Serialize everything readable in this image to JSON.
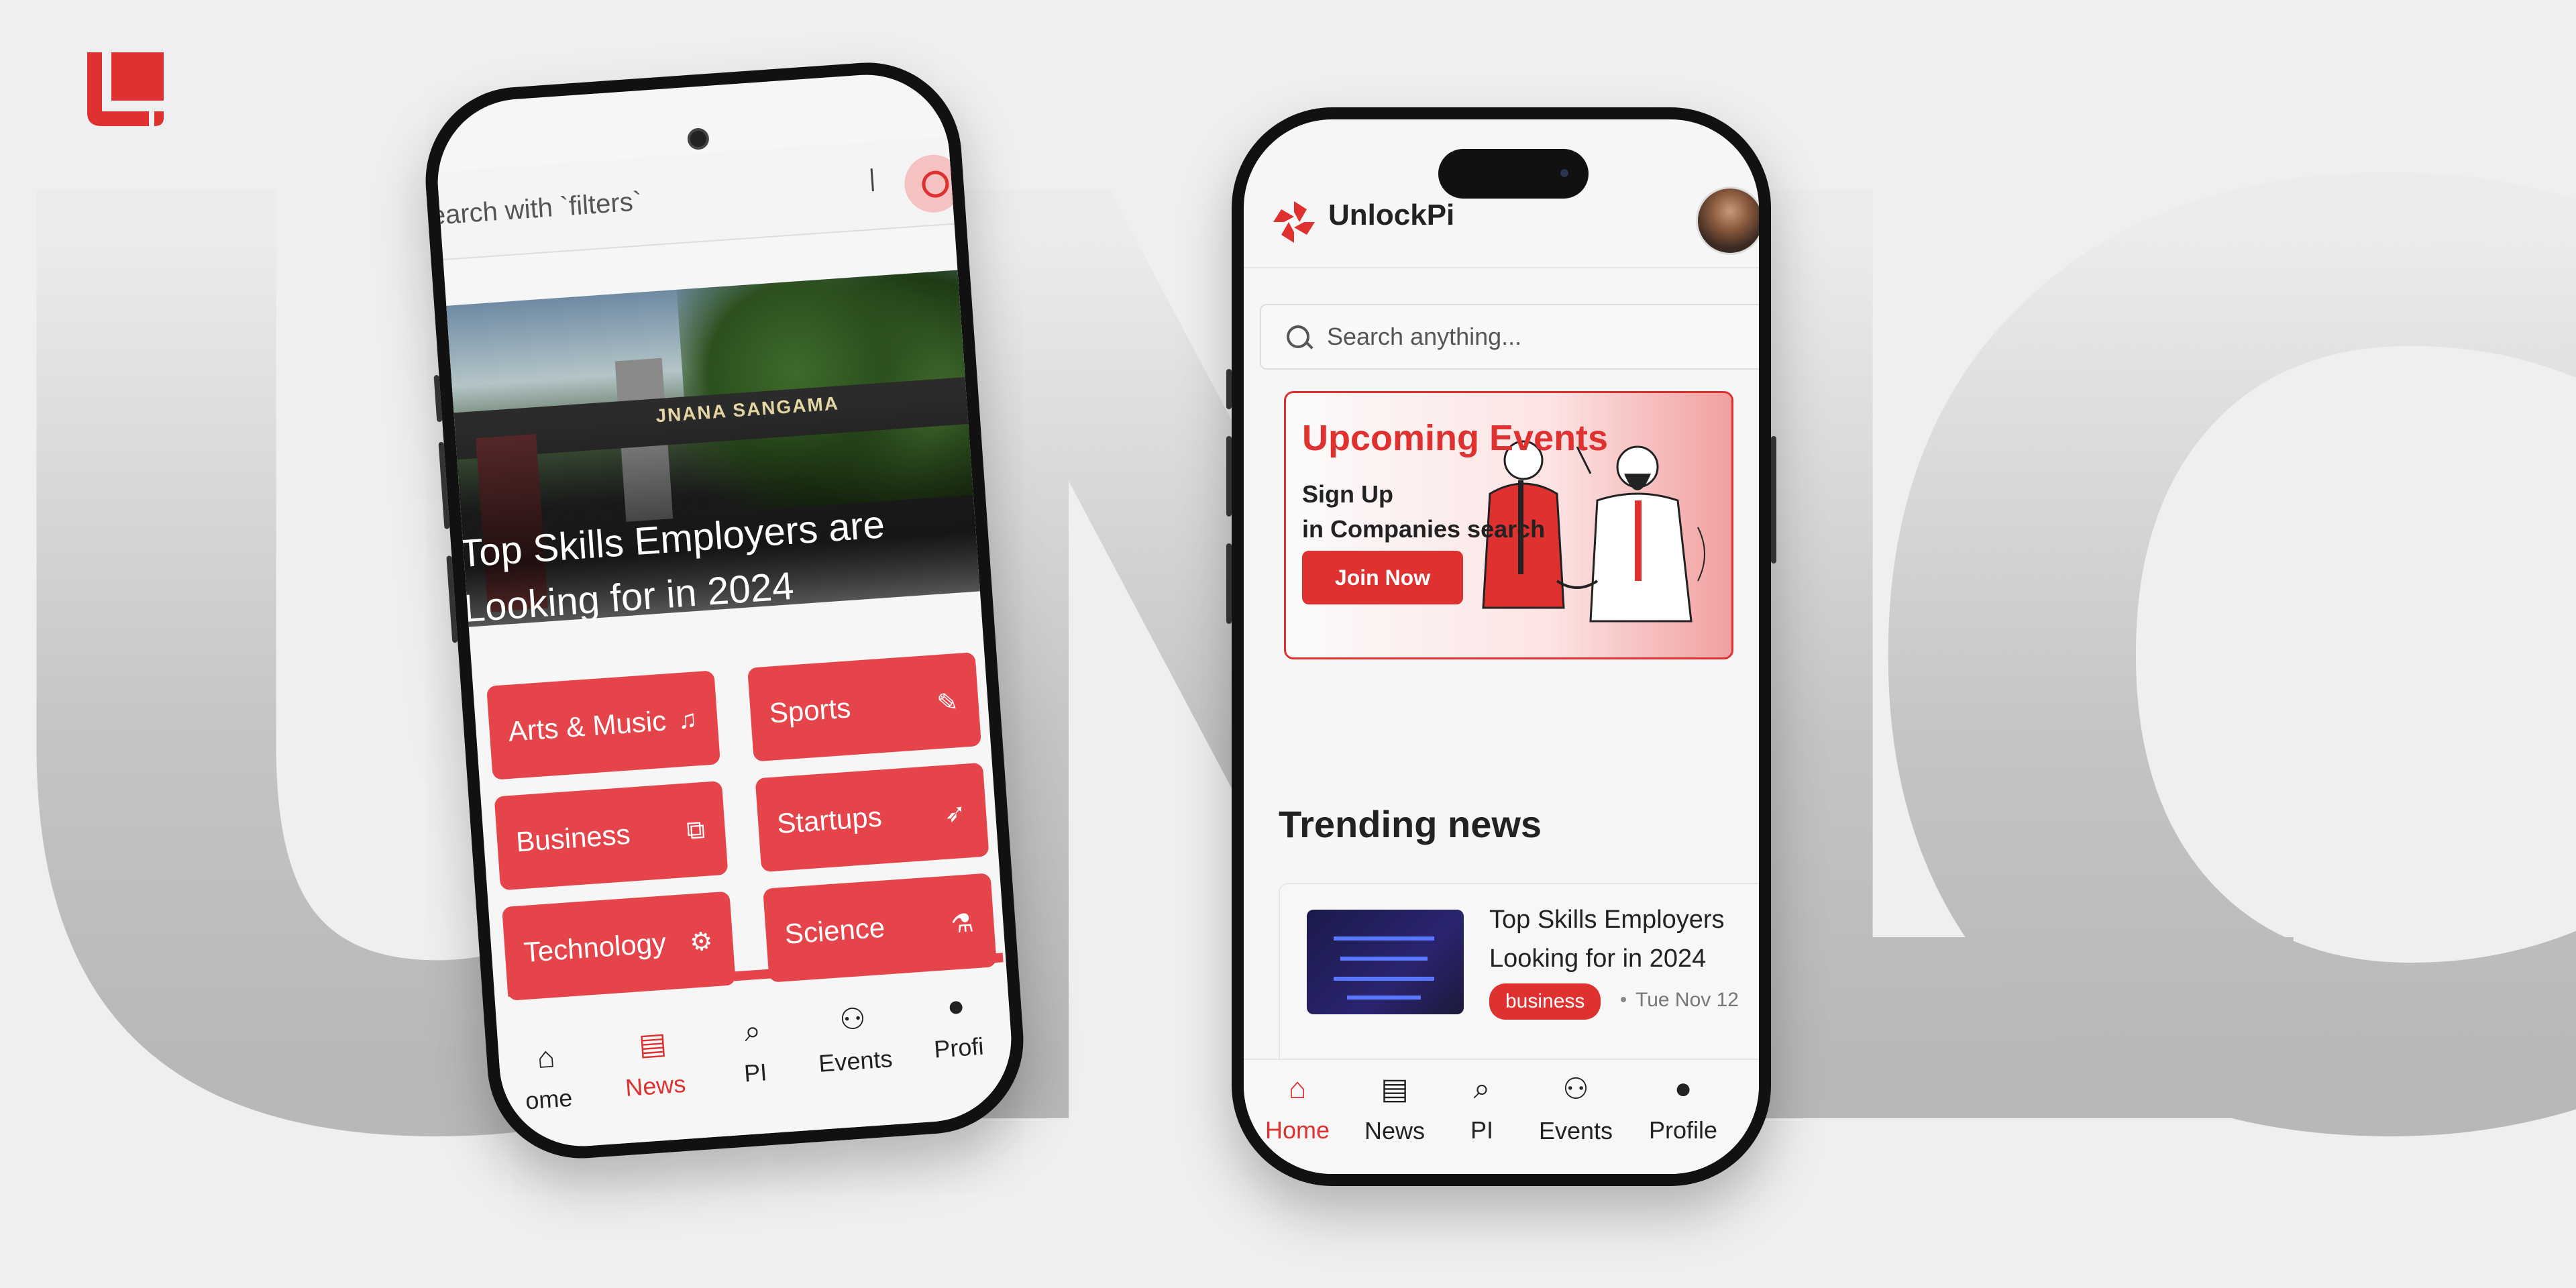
{
  "background": {
    "letters": [
      "U",
      "N",
      "L",
      "C"
    ]
  },
  "left_phone": {
    "search_placeholder": "earch with `filters`",
    "hero_title": "Top Skills Employers are Looking for in 2024",
    "hero_gate_text": "JNANA SANGAMA",
    "categories": [
      {
        "label": "Arts & Music",
        "icon": "♫"
      },
      {
        "label": "Sports",
        "icon": "✎"
      },
      {
        "label": "Business",
        "icon": "⧉"
      },
      {
        "label": "Startups",
        "icon": "➶"
      },
      {
        "label": "Technology",
        "icon": "⚙"
      },
      {
        "label": "Science",
        "icon": "⚗"
      }
    ],
    "nav": [
      {
        "label": "ome",
        "icon": "⌂",
        "active": false
      },
      {
        "label": "News",
        "icon": "▤",
        "active": true
      },
      {
        "label": "PI",
        "icon": "⌕",
        "active": false
      },
      {
        "label": "Events",
        "icon": "⚇",
        "active": false
      },
      {
        "label": "Profi",
        "icon": "●",
        "active": false
      }
    ]
  },
  "right_phone": {
    "brand": "UnlockPi",
    "search_placeholder": "Search anything...",
    "banner": {
      "title": "Upcoming Events",
      "line1": "Sign Up",
      "line2": "in Companies search",
      "button": "Join Now"
    },
    "trending_title": "Trending news",
    "news_card": {
      "title": "Top Skills Employers Looking for in 2024",
      "tag": "business",
      "date": "Tue Nov 12"
    },
    "nav": [
      {
        "label": "Home",
        "icon": "⌂",
        "active": true
      },
      {
        "label": "News",
        "icon": "▤",
        "active": false
      },
      {
        "label": "PI",
        "icon": "⌕",
        "active": false
      },
      {
        "label": "Events",
        "icon": "⚇",
        "active": false
      },
      {
        "label": "Profile",
        "icon": "●",
        "active": false
      }
    ]
  },
  "colors": {
    "accent": "#e03131",
    "category": "#e5454a",
    "background": "#efeff1"
  }
}
